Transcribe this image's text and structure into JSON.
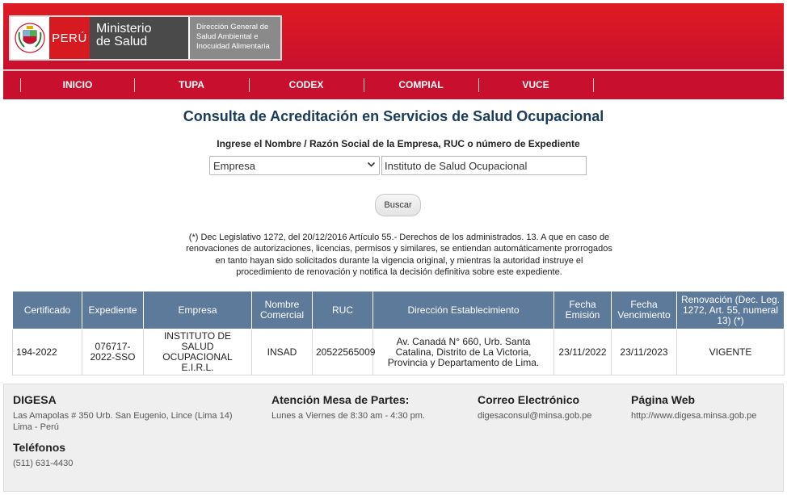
{
  "header": {
    "peru": "PERÚ",
    "ministry_line1": "Ministerio",
    "ministry_line2": "de Salud",
    "agency_line1": "Dirección General de",
    "agency_line2": "Salud Ambiental e",
    "agency_line3": "Inocuidad Alimentaria"
  },
  "nav": {
    "items": [
      {
        "label": "INICIO"
      },
      {
        "label": "TUPA"
      },
      {
        "label": "CODEX"
      },
      {
        "label": "COMPIAL"
      },
      {
        "label": "VUCE"
      }
    ]
  },
  "main": {
    "title": "Consulta de Acreditación en Servicios de Salud Ocupacional",
    "subtitle": "Ingrese el Nombre / Razón Social de la Empresa, RUC o número de Expediente",
    "search_type": "Empresa",
    "search_value": "Instituto de Salud Ocupacional",
    "search_button": "Buscar",
    "note_lines": [
      "(*) Dec Legislativo 1272, del 20/12/2016 Artículo 55.- Derechos de los administrados. 13. A que en caso de",
      "renovaciones de autorizaciones, licencias, permisos y similares, se entiendan automáticamente prorrogados",
      "en tanto hayan sido solicitados durante la vigencia original, y mientras la autoridad instruye el",
      "procedimiento de renovación y notifica la decisión definitiva sobre este expediente."
    ]
  },
  "table": {
    "headers": [
      "Certificado",
      "Expediente",
      "Empresa",
      "Nombre Comercial",
      "RUC",
      "Dirección Establecimiento",
      "Fecha Emisión",
      "Fecha Vencimiento",
      "Renovación (Dec. Leg. 1272, Art. 55, numeral 13) (*)"
    ],
    "rows": [
      {
        "certificado": "194-2022",
        "expediente": "076717-2022-SSO",
        "empresa": "INSTITUTO DE SALUD OCUPACIONAL E.I.R.L.",
        "nombre_comercial": "INSAD",
        "ruc": "20522565009",
        "direccion": "Av. Canadá N° 660, Urb. Santa Catalina, Distrito de La Victoria, Provincia y Departamento de Lima.",
        "fecha_emision": "23/11/2022",
        "fecha_vencimiento": "23/11/2023",
        "renovacion": "VIGENTE"
      }
    ]
  },
  "footer": {
    "digesa_title": "DIGESA",
    "address_line1": "Las Amapolas # 350 Urb. San Eugenio, Lince (Lima 14)",
    "address_line2": "Lima - Perú",
    "phones_title": "Teléfonos",
    "phone": "(511) 631-4430",
    "attention_title": "Atención Mesa de Partes:",
    "attention_hours": "Lunes a Viernes de 8:30 am - 4:30 pm.",
    "email_title": "Correo Electrónico",
    "email": "digesaconsul@minsa.gob.pe",
    "web_title": "Página Web",
    "web": "http://www.digesa.minsa.gob.pe"
  },
  "colors": {
    "header_red": "#c8102e",
    "table_header": "#5d7a9b",
    "title_blue": "#1a3b5c"
  }
}
